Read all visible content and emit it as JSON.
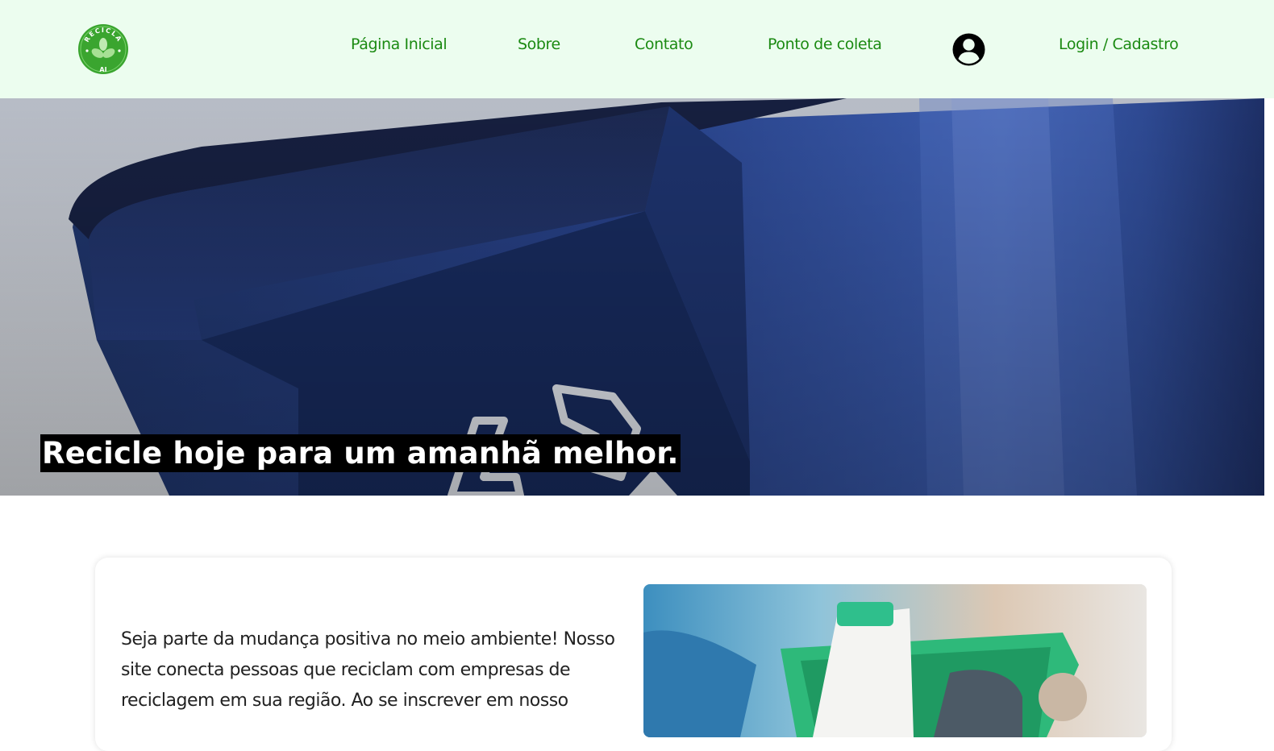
{
  "header": {
    "logo": {
      "top_text": "RECICLA",
      "bottom_text": "AI",
      "color": "#3aa52f"
    },
    "nav": [
      {
        "label": "Página Inicial"
      },
      {
        "label": "Sobre"
      },
      {
        "label": "Contato"
      },
      {
        "label": "Ponto de coleta"
      }
    ],
    "user_icon": "user-circle-icon",
    "login_label": "Login / Cadastro",
    "colors": {
      "background": "#ecfdef",
      "link": "#1b8a12"
    }
  },
  "hero": {
    "title": "Recicle hoje para um amanhã melhor.",
    "image": "blue-recycling-bin-photo"
  },
  "card": {
    "text": "Seja parte da mudança positiva no meio ambiente! Nosso site conecta pessoas que reciclam com empresas de reciclagem em sua região. Ao se inscrever em nosso",
    "image": "recyclables-bag-photo"
  }
}
